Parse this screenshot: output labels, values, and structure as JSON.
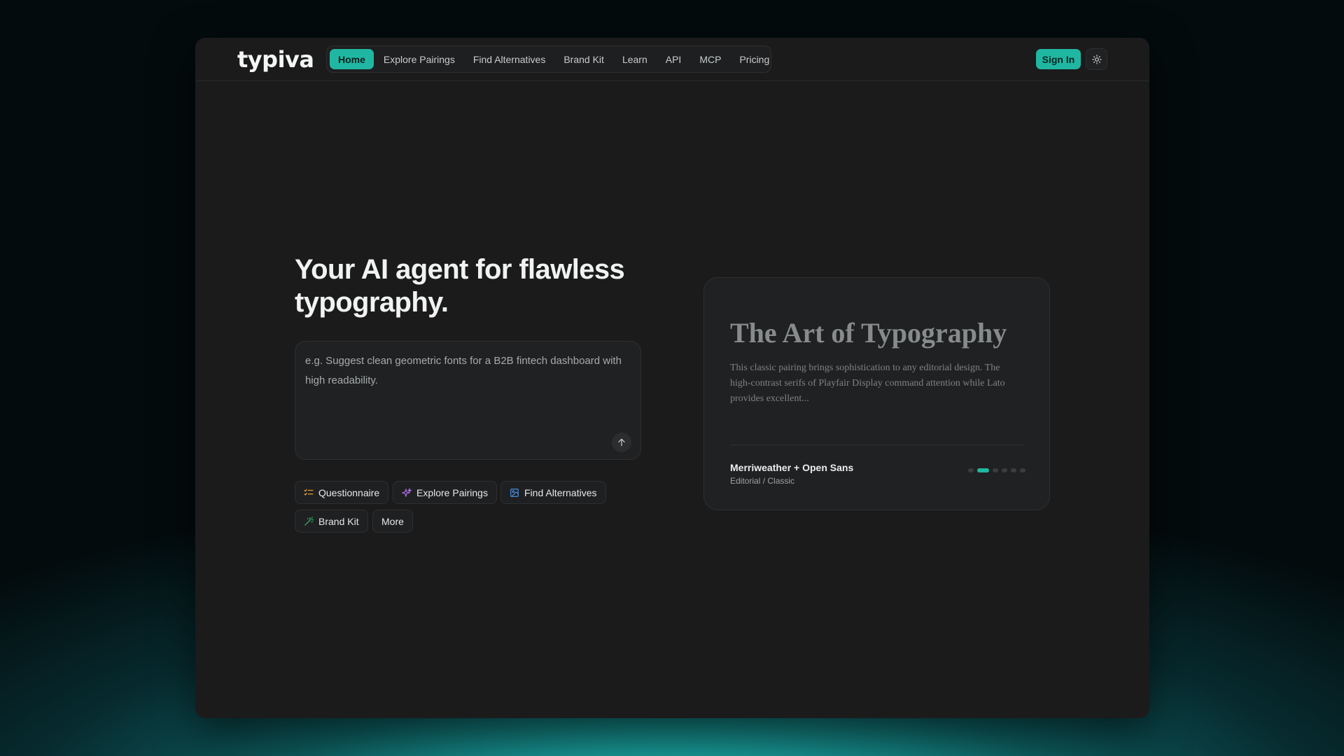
{
  "brand": {
    "name": "typiva"
  },
  "nav": {
    "items": [
      {
        "label": "Home",
        "active": true
      },
      {
        "label": "Explore Pairings",
        "active": false
      },
      {
        "label": "Find Alternatives",
        "active": false
      },
      {
        "label": "Brand Kit",
        "active": false
      },
      {
        "label": "Learn",
        "active": false
      },
      {
        "label": "API",
        "active": false
      },
      {
        "label": "MCP",
        "active": false
      },
      {
        "label": "Pricing",
        "active": false
      }
    ],
    "sign_in_label": "Sign In",
    "theme_icon": "sun-icon"
  },
  "hero": {
    "title": "Your AI agent for flawless typography.",
    "prompt_placeholder": "e.g. Suggest clean geometric fonts for a B2B fintech dashboard with high readability.",
    "prompt_value": ""
  },
  "chips": [
    {
      "label": "Questionnaire",
      "icon": "list-check-icon",
      "color": "#e7a33a"
    },
    {
      "label": "Explore Pairings",
      "icon": "sparkle-icon",
      "color": "#b06be8"
    },
    {
      "label": "Find Alternatives",
      "icon": "image-icon",
      "color": "#4b8ee8"
    },
    {
      "label": "Brand Kit",
      "icon": "wand-icon",
      "color": "#35c46a"
    },
    {
      "label": "More",
      "icon": "",
      "color": ""
    }
  ],
  "preview_card": {
    "title": "The Art of Typography",
    "body": "This classic pairing brings sophistication to any editorial design. The high-contrast serifs of Playfair Display command attention while Lato provides excellent...",
    "pairing": "Merriweather + Open Sans",
    "category": "Editorial / Classic",
    "slide_count": 6,
    "active_slide": 2
  },
  "colors": {
    "accent": "#20b7a2",
    "window_bg": "#1b1b1c"
  }
}
